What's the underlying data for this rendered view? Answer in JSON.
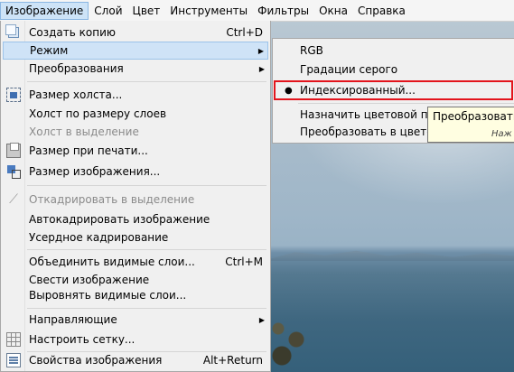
{
  "menubar": [
    {
      "label": "Изображение",
      "active": true
    },
    {
      "label": "Слой"
    },
    {
      "label": "Цвет"
    },
    {
      "label": "Инструменты"
    },
    {
      "label": "Фильтры"
    },
    {
      "label": "Окна"
    },
    {
      "label": "Справка"
    }
  ],
  "image_menu": {
    "items": [
      {
        "label": "Создать копию",
        "shortcut": "Ctrl+D",
        "icon": "copy-icon"
      },
      {
        "label": "Режим",
        "submenu": true,
        "highlighted": true
      },
      {
        "label": "Преобразования",
        "submenu": true
      },
      {
        "label": "Размер холста...",
        "icon": "canvas-size-icon"
      },
      {
        "label": "Холст по размеру слоев"
      },
      {
        "label": "Холст в выделение",
        "disabled": true
      },
      {
        "label": "Размер при печати...",
        "icon": "print-size-icon"
      },
      {
        "label": "Размер изображения...",
        "icon": "scale-image-icon"
      },
      {
        "label": "Откадрировать в выделение",
        "icon": "crop-icon",
        "disabled": true
      },
      {
        "label": "Автокадрировать изображение"
      },
      {
        "label": "Усердное кадрирование"
      },
      {
        "label": "Объединить видимые слои...",
        "shortcut": "Ctrl+M"
      },
      {
        "label": "Свести изображение"
      },
      {
        "label": "Выровнять видимые слои..."
      },
      {
        "label": "Направляющие",
        "submenu": true
      },
      {
        "label": "Настроить сетку...",
        "icon": "grid-icon"
      },
      {
        "label": "Свойства изображения",
        "shortcut": "Alt+Return",
        "icon": "properties-icon"
      }
    ]
  },
  "mode_submenu": {
    "items": [
      {
        "label": "RGB"
      },
      {
        "label": "Градации серого"
      },
      {
        "label": "Индексированный...",
        "selected": true
      },
      {
        "label": "Назначить цветовой проф"
      },
      {
        "label": "Преобразовать в цветовой"
      }
    ]
  },
  "tooltip": {
    "text": "Преобразовать и",
    "hint": "Наж"
  },
  "colors": {
    "highlight": "#cfe3f7",
    "red_box": "#e3141c",
    "tooltip_bg": "#fffee1"
  }
}
